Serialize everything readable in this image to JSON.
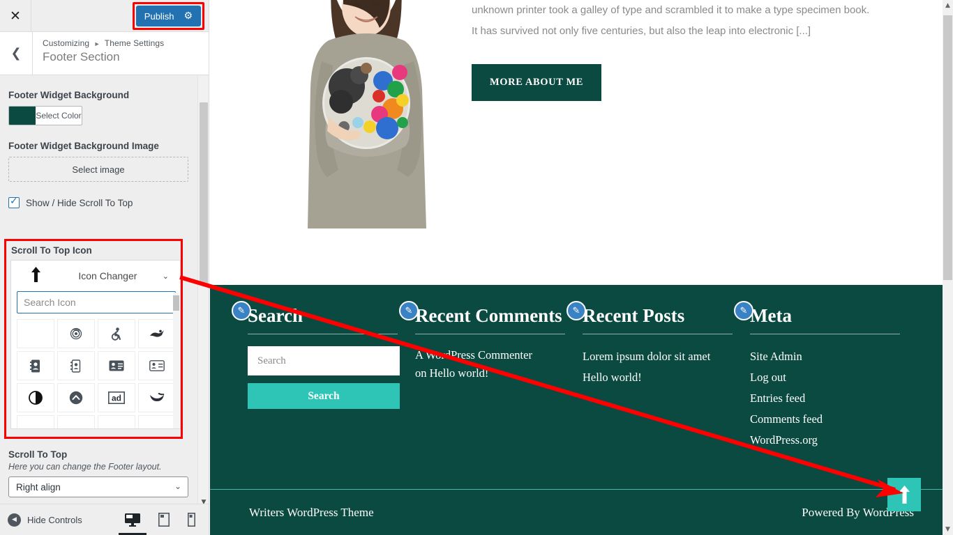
{
  "customizer": {
    "close_icon": "close-icon",
    "publish_label": "Publish",
    "gear_icon": "⚙",
    "back_icon": "‹",
    "breadcrumb_root": "Customizing",
    "breadcrumb_sep": "►",
    "breadcrumb_parent": "Theme Settings",
    "section_title": "Footer Section",
    "controls": {
      "widget_bg_label": "Footer Widget Background",
      "select_color_label": "Select Color",
      "selected_color": "#0a4a40",
      "widget_bg_image_label": "Footer Widget Background Image",
      "select_image_label": "Select image",
      "show_hide_label": "Show / Hide Scroll To Top",
      "show_hide_checked": true,
      "scroll_icon_label": "Scroll To Top Icon",
      "icon_changer_label": "Icon Changer",
      "icon_changer_caret": "⌄",
      "current_icon": "arrow-up-icon",
      "search_placeholder": "Search Icon",
      "search_value": "",
      "icons": [
        "blank-icon",
        "fingerprint-icon",
        "wheelchair-accessible-icon",
        "swimmer-icon",
        "address-book-solid-icon",
        "address-book-outline-icon",
        "address-card-solid-icon",
        "address-card-outline-icon",
        "adjust-icon",
        "angle-up-circle-icon",
        "ad-icon",
        "adn-icon"
      ],
      "scroll_to_top_label": "Scroll To Top",
      "scroll_to_top_desc": "Here you can change the Footer layout.",
      "align_value": "Right align",
      "align_caret": "⌄"
    },
    "footer": {
      "hide_controls_label": "Hide Controls",
      "devices": [
        "desktop-icon",
        "tablet-icon",
        "mobile-icon"
      ],
      "active_device": "desktop-icon"
    }
  },
  "preview": {
    "hero": {
      "paragraph_line1": "unknown printer took a galley of type and scrambled it to make a type specimen book.",
      "paragraph_line2": "It has survived not only five centuries, but also the leap into electronic [...]",
      "cta_label": "MORE ABOUT ME"
    },
    "footer_bg": "#0a4a40",
    "accent": "#2ec4b6",
    "widgets": [
      {
        "title": "Search",
        "pencil": "edit-pencil-icon",
        "search_placeholder": "Search",
        "search_value": "",
        "button_label": "Search"
      },
      {
        "title": "Recent Comments",
        "pencil": "edit-pencil-icon",
        "items": [
          "A WordPress Commenter",
          "on Hello world!"
        ]
      },
      {
        "title": "Recent Posts",
        "pencil": "edit-pencil-icon",
        "items": [
          "Lorem ipsum dolor sit amet",
          "Hello world!"
        ]
      },
      {
        "title": "Meta",
        "pencil": "edit-pencil-icon",
        "items": [
          "Site Admin",
          "Log out",
          "Entries feed",
          "Comments feed",
          "WordPress.org"
        ]
      }
    ],
    "footer_bottom": {
      "left_text": "Writers WordPress Theme",
      "right_text": "Powered By WordPress"
    },
    "scroll_to_top_icon": "arrow-up-icon"
  },
  "annotations": {
    "highlight_color": "#ff0000",
    "arrow_color": "#ff0000"
  }
}
